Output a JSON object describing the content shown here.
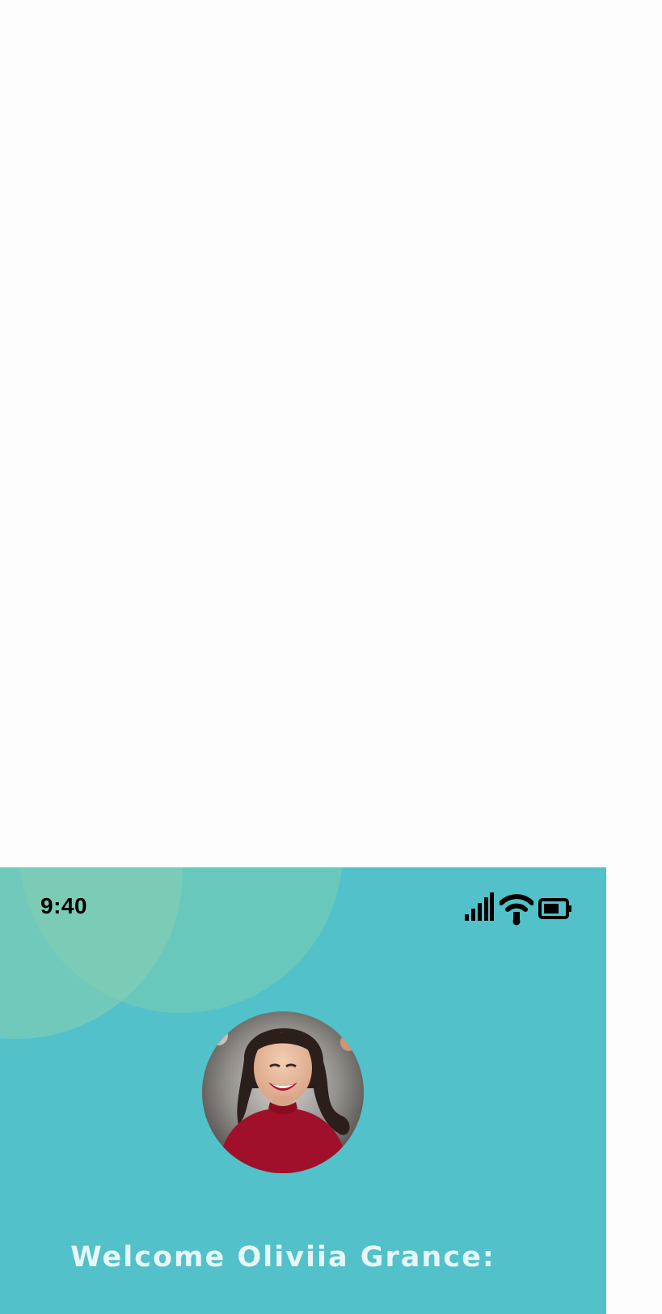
{
  "status_bar": {
    "time": "9:40",
    "icons": [
      "signal-icon",
      "wifi-icon",
      "battery-icon"
    ]
  },
  "profile": {
    "avatar": "avatar"
  },
  "welcome": {
    "text": "Welcome Oliviia Grance:"
  },
  "colors": {
    "page_background": "#fdfdfd",
    "panel_background": "#52c1c9",
    "bubble_large": "#69c8bc",
    "bubble_small": "#86cfb2",
    "welcome_text": "#e7f7f7",
    "sweater": "#a0102a"
  }
}
